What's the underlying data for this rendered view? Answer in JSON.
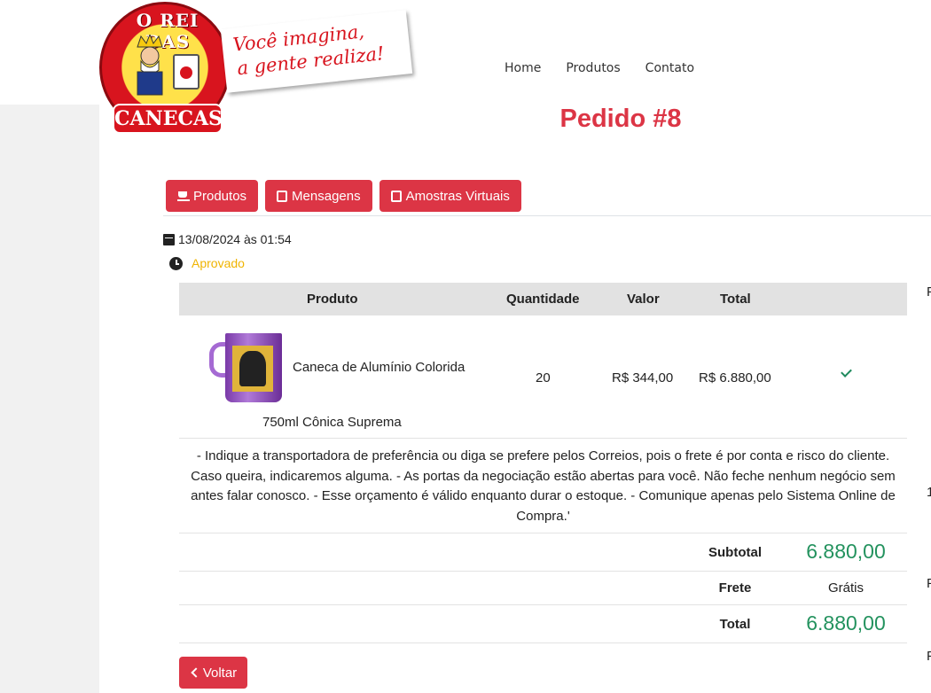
{
  "brand": {
    "name_top": "O REI DAS",
    "name_bottom": "CANECAS",
    "tagline_line1": "Você imagina,",
    "tagline_line2": "a gente realiza!"
  },
  "nav": {
    "home": "Home",
    "products": "Produtos",
    "contact": "Contato"
  },
  "page": {
    "title": "Pedido #8"
  },
  "tabs": [
    {
      "label": "Produtos",
      "icon": "cup-icon"
    },
    {
      "label": "Mensagens",
      "icon": "note-icon"
    },
    {
      "label": "Amostras Virtuais",
      "icon": "note-icon"
    }
  ],
  "order": {
    "date": "13/08/2024 às 01:54",
    "status": "Aprovado",
    "status_color": "#f0b400"
  },
  "table": {
    "headers": {
      "product": "Produto",
      "quantity": "Quantidade",
      "value": "Valor",
      "total": "Total"
    },
    "rows": [
      {
        "name": "Caneca de Alumínio Colorida",
        "variant": "750ml Cônica Suprema",
        "quantity": "20",
        "value": "R$ 344,00",
        "total": "R$ 6.880,00",
        "status_icon": "check-icon"
      }
    ],
    "note": "- Indique a transportadora de preferência ou diga se prefere pelos Correios, pois o frete é por conta e risco do cliente. Caso queira, indicaremos alguma. - As portas da negociação estão abertas para você. Não feche nenhum negócio sem antes falar conosco. - Esse orçamento é válido enquanto durar o estoque. - Comunique apenas pelo Sistema Online de Compra.'"
  },
  "summary": {
    "subtotal_label": "Subtotal",
    "subtotal_value": "6.880,00",
    "shipping_label": "Frete",
    "shipping_value": "Grátis",
    "total_label": "Total",
    "total_value": "6.880,00"
  },
  "actions": {
    "back": "Voltar"
  },
  "colors": {
    "accent": "#dc3545",
    "money": "#23925e"
  },
  "edge_glyphs": [
    "F",
    "1",
    "F",
    "F"
  ]
}
